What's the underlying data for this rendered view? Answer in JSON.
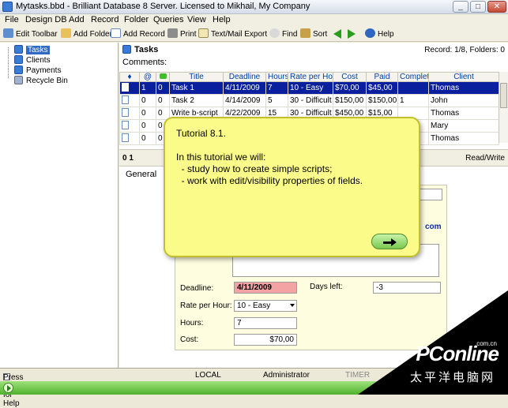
{
  "window": {
    "title": "Mytasks.bbd - Brilliant Database 8 Server. Licensed to Mikhail, My Company"
  },
  "menu": [
    "File",
    "Design DB",
    "Add",
    "Record",
    "Folder",
    "Queries",
    "View",
    "Help"
  ],
  "toolbar": {
    "edit_toolbar": "Edit Toolbar",
    "add_folder": "Add Folder",
    "add_record": "Add Record",
    "print": "Print",
    "text_mail_export": "Text/Mail Export",
    "find": "Find",
    "sort": "Sort",
    "help": "Help"
  },
  "tree": [
    "Tasks",
    "Clients",
    "Payments",
    "Recycle Bin"
  ],
  "main": {
    "title": "Tasks",
    "record_info": "Record: 1/8, Folders: 0",
    "comments_label": "Comments:",
    "columns": [
      "♦",
      "@",
      "",
      "Title",
      "Deadline",
      "Hours",
      "Rate per Hour",
      "Cost",
      "Paid",
      "Complete",
      "Client"
    ],
    "rows": [
      [
        "1",
        "0",
        "Task 1",
        "4/11/2009",
        "7",
        "10 - Easy",
        "$70,00",
        "$45,00",
        "",
        "Thomas"
      ],
      [
        "0",
        "0",
        "Task 2",
        "4/14/2009",
        "5",
        "30 - Difficult",
        "$150,00",
        "$150,00",
        "1",
        "John"
      ],
      [
        "0",
        "0",
        "Write b-script",
        "4/22/2009",
        "15",
        "30 - Difficult",
        "$450,00",
        "$15,00",
        "",
        "Thomas"
      ],
      [
        "0",
        "0",
        "",
        "",
        "",
        "",
        "",
        "",
        "",
        "Mary"
      ],
      [
        "0",
        "0",
        "",
        "",
        "",
        "",
        "",
        "",
        "",
        "Thomas"
      ]
    ],
    "lower_tab_count": "0 1",
    "read_write": "Read/Write",
    "tab_general": "General"
  },
  "form": {
    "deadline_label": "Deadline:",
    "deadline_value": "4/11/2009",
    "days_left_label": "Days left:",
    "days_left_value": "-3",
    "rate_label": "Rate per Hour:",
    "rate_value": "10 - Easy",
    "hours_label": "Hours:",
    "hours_value": "7",
    "cost_label": "Cost:",
    "cost_value": "$70,00",
    "com_fragment": "com"
  },
  "note": {
    "heading": "Tutorial 8.1.",
    "intro": "In this tutorial we will:",
    "item1": "  - study how to create simple scripts;",
    "item2": "  - work with edit/visibility properties of fields."
  },
  "status": {
    "help": "Press F1 for Help",
    "server": "LOCAL",
    "user": "Administrator",
    "timer": "TIMER"
  },
  "watermark": {
    "brand": "PConline",
    "domain": ".com.cn",
    "chinese": "太平洋电脑网"
  }
}
